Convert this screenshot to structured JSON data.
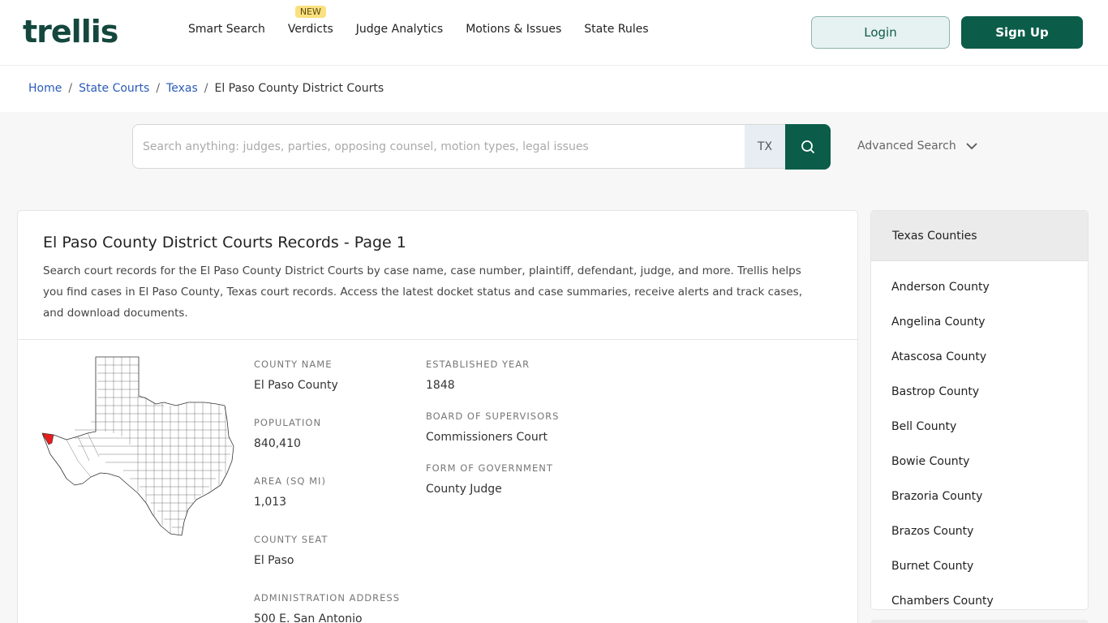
{
  "header": {
    "logo_text": "trellis",
    "nav": [
      {
        "label": "Smart Search"
      },
      {
        "label": "Verdicts",
        "badge": "NEW"
      },
      {
        "label": "Judge Analytics"
      },
      {
        "label": "Motions & Issues"
      },
      {
        "label": "State Rules"
      }
    ],
    "login_label": "Login",
    "signup_label": "Sign Up"
  },
  "breadcrumb": {
    "items": [
      "Home",
      "State Courts",
      "Texas"
    ],
    "current": "El Paso County District Courts"
  },
  "search": {
    "placeholder": "Search anything: judges, parties, opposing counsel, motion types, legal issues",
    "state": "TX",
    "advanced_label": "Advanced Search"
  },
  "main": {
    "title": "El Paso County District Courts Records - Page 1",
    "description": "Search court records for the El Paso County District Courts by case name, case number, plaintiff, defendant, judge, and more. Trellis helps you find cases in El Paso County, Texas court records. Access the latest docket status and case summaries, receive alerts and track cases, and download documents.",
    "info_left": [
      {
        "label": "County Name",
        "value": "El Paso County"
      },
      {
        "label": "Population",
        "value": "840,410"
      },
      {
        "label": "Area (Sq Mi)",
        "value": "1,013"
      },
      {
        "label": "County Seat",
        "value": "El Paso"
      },
      {
        "label": "Administration Address",
        "value": "500 E. San Antonio"
      }
    ],
    "info_right": [
      {
        "label": "Established Year",
        "value": "1848"
      },
      {
        "label": "Board of Supervisors",
        "value": "Commissioners Court"
      },
      {
        "label": "Form of Government",
        "value": "County Judge"
      }
    ],
    "map_highlight_color": "#e81c1c"
  },
  "sidebar": {
    "title": "Texas Counties",
    "items": [
      "Anderson County",
      "Angelina County",
      "Atascosa County",
      "Bastrop County",
      "Bell County",
      "Bowie County",
      "Brazoria County",
      "Brazos County",
      "Burnet County",
      "Chambers County"
    ]
  },
  "colors": {
    "brand": "#0b5d4a",
    "link": "#2a5bb8",
    "badge": "#fbe07f"
  }
}
